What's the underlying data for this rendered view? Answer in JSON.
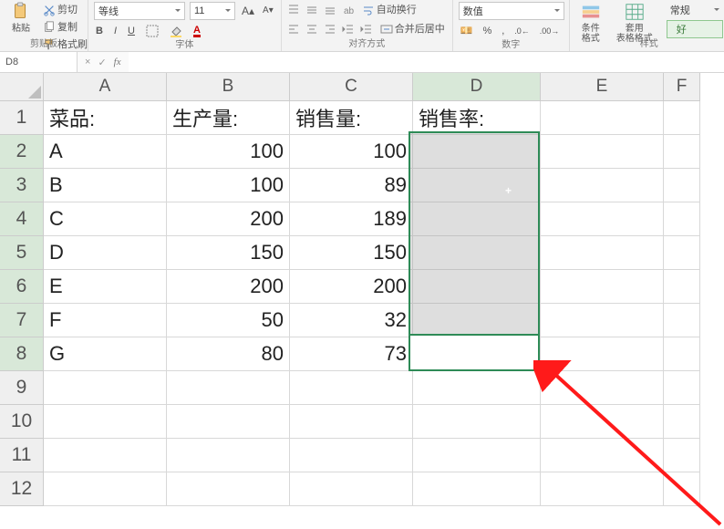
{
  "ribbon": {
    "clipboard": {
      "label": "剪贴板",
      "paste": "粘贴",
      "cut": "剪切",
      "copy": "复制",
      "fmt": "格式刷"
    },
    "font": {
      "label": "字体",
      "family": "等线",
      "size": "11"
    },
    "align": {
      "label": "对齐方式",
      "wrap": "自动换行",
      "merge": "合并后居中"
    },
    "number": {
      "label": "数字",
      "fmt": "数值"
    },
    "styles": {
      "label": "样式",
      "cond": "条件格式",
      "table": "套用\n表格格式",
      "good": "好"
    },
    "normal": "常规"
  },
  "fbar": {
    "namebox": "D8",
    "formula": ""
  },
  "column_headers": [
    "A",
    "B",
    "C",
    "D",
    "E",
    "F"
  ],
  "row_headers": [
    "1",
    "2",
    "3",
    "4",
    "5",
    "6",
    "7",
    "8",
    "9",
    "10",
    "11",
    "12"
  ],
  "sheet": {
    "headers": {
      "A": "菜品:",
      "B": "生产量:",
      "C": "销售量:",
      "D": "销售率:"
    },
    "rows": [
      {
        "a": "A",
        "b": "100",
        "c": "100"
      },
      {
        "a": "B",
        "b": "100",
        "c": "89"
      },
      {
        "a": "C",
        "b": "200",
        "c": "189"
      },
      {
        "a": "D",
        "b": "150",
        "c": "150"
      },
      {
        "a": "E",
        "b": "200",
        "c": "200"
      },
      {
        "a": "F",
        "b": "50",
        "c": "32"
      },
      {
        "a": "G",
        "b": "80",
        "c": "73"
      }
    ]
  },
  "chart_data": {
    "type": "table",
    "title": "",
    "columns": [
      "菜品",
      "生产量",
      "销售量",
      "销售率"
    ],
    "rows": [
      [
        "A",
        100,
        100,
        null
      ],
      [
        "B",
        100,
        89,
        null
      ],
      [
        "C",
        200,
        189,
        null
      ],
      [
        "D",
        150,
        150,
        null
      ],
      [
        "E",
        200,
        200,
        null
      ],
      [
        "F",
        50,
        32,
        null
      ],
      [
        "G",
        80,
        73,
        null
      ]
    ]
  }
}
